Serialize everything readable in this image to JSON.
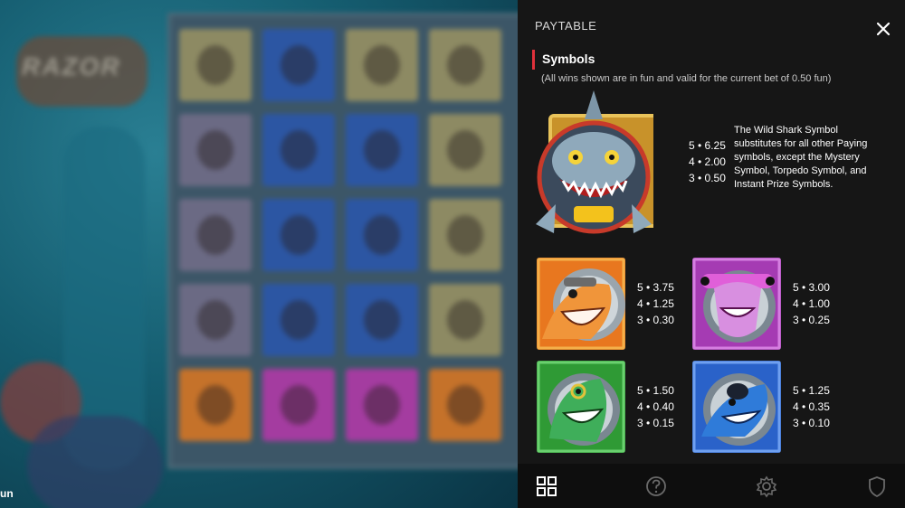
{
  "background": {
    "logo_text": "RAZOR",
    "balance_label": "un"
  },
  "paytable": {
    "title": "PAYTABLE",
    "section_title": "Symbols",
    "note": "(All wins shown are in fun and valid for the current bet of 0.50 fun)",
    "wild": {
      "icon": "wild-shark-icon",
      "payouts": [
        "5 • 6.25",
        "4 • 2.00",
        "3 • 0.50"
      ],
      "description": "The Wild Shark Symbol substitutes for all other Paying symbols, except the Mystery Symbol, Torpedo Symbol, and Instant Prize Symbols."
    },
    "symbols": [
      {
        "icon": "orange-shark-icon",
        "color": "#e8771f",
        "payouts": [
          "5 • 3.75",
          "4 • 1.25",
          "3 • 0.30"
        ]
      },
      {
        "icon": "pink-hammerhead-icon",
        "color": "#b03ab8",
        "payouts": [
          "5 • 3.00",
          "4 • 1.00",
          "3 • 0.25"
        ]
      },
      {
        "icon": "green-shark-icon",
        "color": "#2f9a35",
        "payouts": [
          "5 • 1.50",
          "4 • 0.40",
          "3 • 0.15"
        ]
      },
      {
        "icon": "blue-shark-icon",
        "color": "#2a62c9",
        "payouts": [
          "5 • 1.25",
          "4 • 0.35",
          "3 • 0.10"
        ]
      }
    ]
  },
  "bottom_nav": [
    "paytable-grid-icon",
    "help-icon",
    "settings-icon",
    "responsible-gaming-shield-icon"
  ]
}
